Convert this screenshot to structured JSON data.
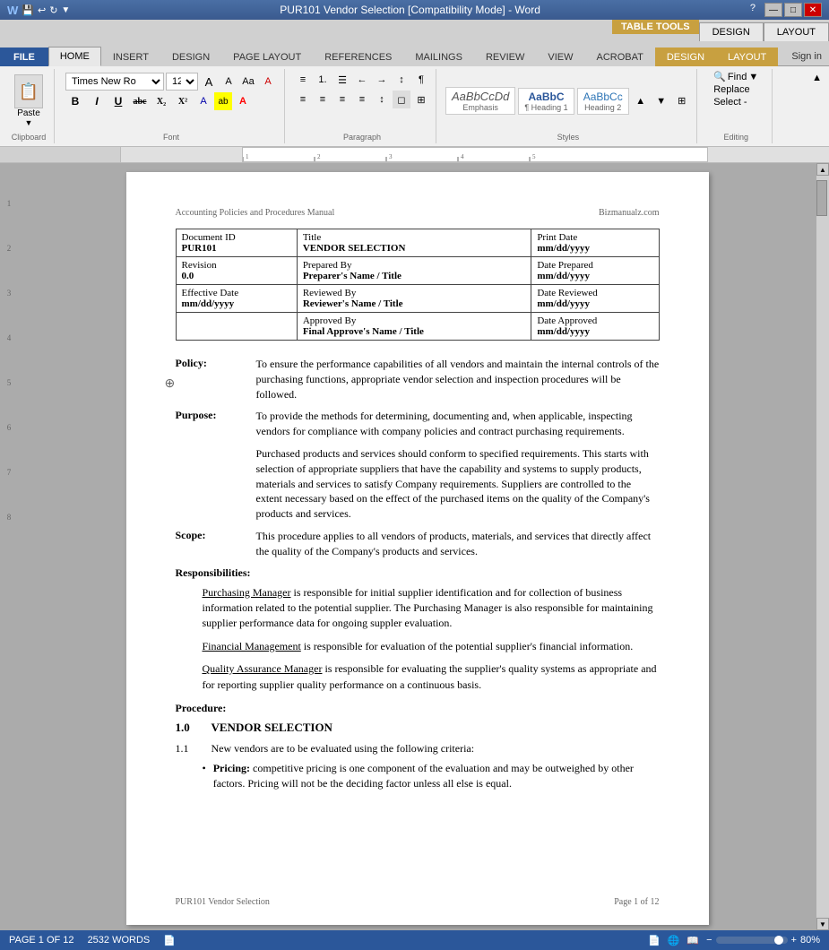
{
  "titlebar": {
    "title": "PUR101 Vendor Selection [Compatibility Mode] - Word",
    "controls": [
      "?",
      "—",
      "□",
      "✕"
    ]
  },
  "tabletools": {
    "label": "TABLE TOOLS",
    "tabs": [
      "DESIGN",
      "LAYOUT"
    ]
  },
  "ribbontabs": {
    "tabs": [
      "FILE",
      "HOME",
      "INSERT",
      "DESIGN",
      "PAGE LAYOUT",
      "REFERENCES",
      "MAILINGS",
      "REVIEW",
      "VIEW",
      "ACROBAT",
      "DESIGN",
      "LAYOUT"
    ],
    "active": "HOME",
    "signIn": "Sign in"
  },
  "ribbon": {
    "clipboard_label": "Clipboard",
    "paste_label": "Paste",
    "font_label": "Font",
    "font_name": "Times New Ro",
    "font_size": "12",
    "paragraph_label": "Paragraph",
    "styles_label": "Styles",
    "editing_label": "Editing",
    "find_label": "Find",
    "replace_label": "Replace",
    "select_label": "Select -",
    "bold": "B",
    "italic": "I",
    "underline": "U",
    "strikethrough": "abc",
    "subscript": "X₂",
    "superscript": "X²",
    "style_emphasis_label": "Emphasis",
    "style_heading1_label": "¶ Heading 1",
    "style_heading2_label": "Heading 2",
    "styles_preview": [
      "AaBbCcDd",
      "AaBbC",
      "AaBbCc"
    ]
  },
  "document": {
    "header_left": "Accounting Policies and Procedures Manual",
    "header_right": "Bizmanualz.com",
    "table": {
      "rows": [
        [
          {
            "label": "Document ID",
            "value": "PUR101"
          },
          {
            "label": "Title",
            "value": "VENDOR SELECTION"
          },
          {
            "label": "Print Date",
            "value": "mm/dd/yyyy"
          }
        ],
        [
          {
            "label": "Revision",
            "value": "0.0"
          },
          {
            "label": "Prepared By",
            "value": "Preparer's Name / Title"
          },
          {
            "label": "Date Prepared",
            "value": "mm/dd/yyyy"
          }
        ],
        [
          {
            "label": "Effective Date",
            "value": "mm/dd/yyyy"
          },
          {
            "label": "Reviewed By",
            "value": "Reviewer's Name / Title"
          },
          {
            "label": "Date Reviewed",
            "value": "mm/dd/yyyy"
          }
        ],
        [
          {
            "label": "",
            "value": ""
          },
          {
            "label": "Approved By",
            "value": "Final Approve's Name / Title"
          },
          {
            "label": "Date Approved",
            "value": "mm/dd/yyyy"
          }
        ]
      ]
    },
    "policy_label": "Policy:",
    "policy_text": "To ensure the performance capabilities of all vendors and maintain the internal controls of the purchasing functions, appropriate vendor selection and inspection procedures will be followed.",
    "purpose_label": "Purpose:",
    "purpose_text1": "To provide the methods for determining, documenting and, when applicable, inspecting vendors for compliance with company policies and contract purchasing requirements.",
    "purpose_text2": "Purchased products and services should conform to specified requirements.  This starts with selection of appropriate suppliers that have the capability and systems to supply products, materials and services to satisfy Company requirements.  Suppliers are controlled to the extent necessary based on the effect of the purchased items on the quality of the Company's products and services.",
    "scope_label": "Scope:",
    "scope_text": "This procedure applies to all vendors of products, materials, and services that directly affect the quality of the Company's products and services.",
    "responsibilities_label": "Responsibilities:",
    "resp_text1_link": "Purchasing Manager",
    "resp_text1": " is responsible for initial supplier identification and for collection of business information related to the potential supplier. The Purchasing Manager is also responsible for maintaining supplier performance data for ongoing suppler evaluation.",
    "resp_text2_link": "Financial Management",
    "resp_text2": " is responsible for evaluation of the potential supplier's financial information.",
    "resp_text3_link": "Quality Assurance Manager",
    "resp_text3": " is responsible for evaluating the supplier's quality systems as appropriate and for reporting supplier quality performance on a continuous basis.",
    "procedure_label": "Procedure:",
    "procedure_number": "1.0",
    "procedure_title": "VENDOR SELECTION",
    "item_1_1": "1.1",
    "item_1_1_text": "New vendors are to be evaluated using the following criteria:",
    "bullet_label": "•",
    "bullet_pricing_bold": "Pricing:",
    "bullet_pricing_text": " competitive pricing is one component of the evaluation and may be outweighed by other factors.  Pricing will not be the deciding factor unless all else is equal.",
    "footer_left": "PUR101 Vendor Selection",
    "footer_right": "Page 1 of 12"
  },
  "statusbar": {
    "page_info": "PAGE 1 OF 12",
    "word_count": "2532 WORDS",
    "zoom_level": "80%",
    "view_icons": [
      "📄",
      "📋",
      "📊"
    ]
  }
}
